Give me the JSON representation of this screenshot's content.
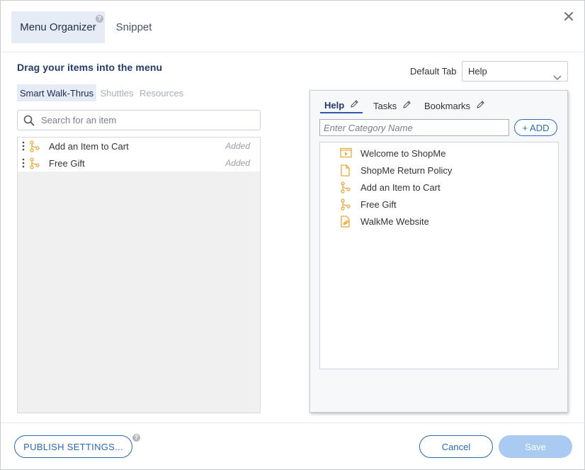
{
  "header": {
    "tabs": [
      {
        "label": "Menu Organizer",
        "active": true
      },
      {
        "label": "Snippet",
        "active": false
      }
    ],
    "help_badge": "?",
    "close_icon": "close-icon"
  },
  "left": {
    "title": "Drag your items into the menu",
    "tabs": [
      {
        "label": "Smart Walk-Thrus",
        "active": true
      },
      {
        "label": "Shuttles",
        "active": false
      },
      {
        "label": "Resources",
        "active": false
      }
    ],
    "search": {
      "placeholder": "Search for an item",
      "value": ""
    },
    "items": [
      {
        "label": "Add an Item to Cart",
        "status": "Added",
        "icon": "walkthru-icon"
      },
      {
        "label": "Free Gift",
        "status": "Added",
        "icon": "walkthru-icon"
      }
    ]
  },
  "right": {
    "default_tab_label": "Default Tab",
    "default_tab_value": "Help",
    "menu_tabs": [
      {
        "label": "Help",
        "active": true
      },
      {
        "label": "Tasks",
        "active": false
      },
      {
        "label": "Bookmarks",
        "active": false
      }
    ],
    "category_input": {
      "placeholder": "Enter Category Name",
      "value": ""
    },
    "add_label": "+ ADD",
    "menu_items": [
      {
        "label": "Welcome to ShopMe",
        "icon": "video-icon"
      },
      {
        "label": "ShopMe Return Policy",
        "icon": "document-icon"
      },
      {
        "label": "Add an Item to Cart",
        "icon": "walkthru-icon"
      },
      {
        "label": "Free Gift",
        "icon": "walkthru-icon"
      },
      {
        "label": "WalkMe Website",
        "icon": "link-icon"
      }
    ]
  },
  "footer": {
    "publish_label": "PUBLISH SETTINGS...",
    "cancel_label": "Cancel",
    "save_label": "Save"
  },
  "colors": {
    "accent": "#2b6ab5",
    "icon": "#e8a93a",
    "active_tab_bg": "#e6ecf6",
    "save_disabled": "#a9cbf1"
  }
}
